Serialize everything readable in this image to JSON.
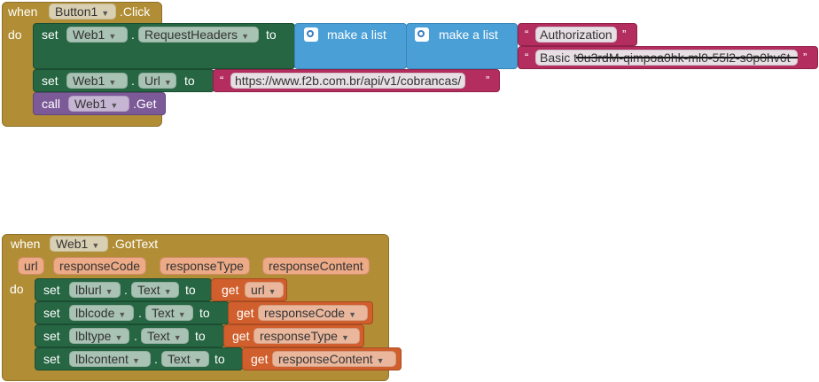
{
  "kw": {
    "when": "when",
    "do": "do",
    "set": "set",
    "call": "call",
    "to": "to",
    "get": "get",
    "dot": ".",
    "quote": "“",
    "quote_close": "”"
  },
  "event1": {
    "component": "Button1",
    "event": ".Click",
    "set_headers": {
      "component": "Web1",
      "property": "RequestHeaders"
    },
    "make_list_label": "make a list",
    "header_key": "Authorization",
    "header_value": "Basic t0u3rdM-qimpoa0hk-ml0-55l2-s0p0hv6t",
    "set_url": {
      "component": "Web1",
      "property": "Url",
      "value": "https://www.f2b.com.br/api/v1/cobrancas/"
    },
    "call": {
      "component": "Web1",
      "method": ".Get"
    }
  },
  "event2": {
    "component": "Web1",
    "event": ".GotText",
    "params": [
      "url",
      "responseCode",
      "responseType",
      "responseContent"
    ],
    "sets": [
      {
        "component": "lblurl",
        "property": "Text",
        "var": "url"
      },
      {
        "component": "lblcode",
        "property": "Text",
        "var": "responseCode"
      },
      {
        "component": "lbltype",
        "property": "Text",
        "var": "responseType"
      },
      {
        "component": "lblcontent",
        "property": "Text",
        "var": "responseContent"
      }
    ]
  },
  "icons": {
    "mutator": "gear-icon",
    "dropdown": "triangle-down-icon"
  }
}
